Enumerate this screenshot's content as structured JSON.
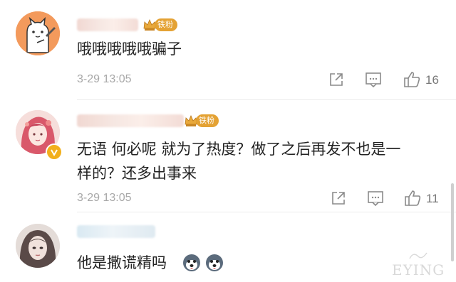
{
  "comments": [
    {
      "badge": "铁粉",
      "text": "哦哦哦哦哦骗子",
      "time": "3-29 13:05",
      "likes": "16"
    },
    {
      "badge": "铁粉",
      "text_line1": "无语 何必呢 就为了热度？做了之后再发不也是一",
      "text_line2": "样的？还多出事来",
      "time": "3-29 13:05",
      "likes": "11"
    },
    {
      "text": "他是撒谎精吗"
    }
  ],
  "watermark": "EYING",
  "colors": {
    "badge": "#e4a234",
    "time": "#a8a8a8",
    "icon": "#8a8a8a"
  }
}
